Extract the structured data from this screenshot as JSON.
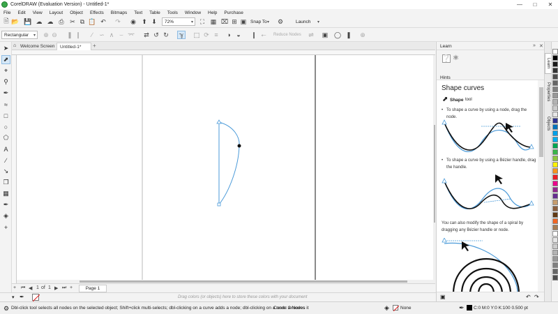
{
  "window": {
    "title": "CorelDRAW (Evaluation Version) - Untitled-1*"
  },
  "menu": [
    "File",
    "Edit",
    "View",
    "Layout",
    "Object",
    "Effects",
    "Bitmaps",
    "Text",
    "Table",
    "Tools",
    "Window",
    "Help",
    "Purchase"
  ],
  "std_toolbar": {
    "zoom": "72%",
    "snap_to": "Snap To",
    "launch": "Launch"
  },
  "property_bar": {
    "mode": "Rectangular",
    "reduce_nodes": "Reduce Nodes"
  },
  "tabs": [
    "Welcome Screen",
    "Untitled-1*"
  ],
  "page_nav": {
    "current": "1",
    "of": "of",
    "total": "1",
    "page_tab": "Page 1"
  },
  "color_hint": "Drag colors (or objects) here to store these colors with your document",
  "status": {
    "hint": "Dbl-click tool selects all nodes on the selected object; Shift+click multi-selects; dbl-clicking on a curve adds a node; dbl-clicking on a node removes it",
    "selection": "Curve: 2 Nodes",
    "fill": "None",
    "outline": "C:0 M:0 Y:0 K:100  0.500 pt"
  },
  "docker": {
    "title": "Learn",
    "hints_label": "Hints",
    "heading": "Shape curves",
    "tool_name": "Shape",
    "tool_suffix": "tool",
    "tip1": "To shape a curve by using a node, drag the node.",
    "tip2a": "To shape a curve by using a Bézier handle, drag",
    "tip2b": "the handle.",
    "tip3a": "You can also modify the shape of a spiral by",
    "tip3b": "dragging any Bézier handle or node."
  },
  "side_tabs": [
    "Learn",
    "Properties",
    "Objects"
  ],
  "palette": [
    "#ffffff",
    "#000000",
    "#1a1a1a",
    "#333333",
    "#4d4d4d",
    "#666666",
    "#808080",
    "#999999",
    "#b3b3b3",
    "#cccccc",
    "#e6e6e6",
    "#2e3192",
    "#0072bc",
    "#00a0e9",
    "#00aeef",
    "#00a651",
    "#39b54a",
    "#8dc63f",
    "#fff200",
    "#f7941d",
    "#ed1c24",
    "#ec008c",
    "#92278f",
    "#662d91",
    "#c69c6d",
    "#8b5e3c",
    "#603913",
    "#f26522",
    "#a67c52",
    "#ffffff",
    "#e6e6e6",
    "#cccccc",
    "#b3b3b3",
    "#999999",
    "#808080",
    "#666666",
    "#4d4d4d"
  ],
  "colors": {
    "accent": "#3b8fd6",
    "curve": "#4a9ad9"
  }
}
